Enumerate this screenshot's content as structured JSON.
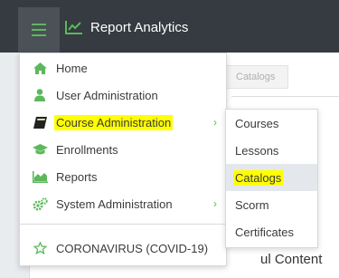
{
  "header": {
    "app_title": "Report Analytics",
    "menu_icon": "hamburger-icon",
    "brand_icon": "line-chart-icon",
    "accent": "#5cb85c",
    "bar_color": "#353b40"
  },
  "background": {
    "breadcrumb": "Catalogs",
    "heading_fragment": "ul Content"
  },
  "menu": {
    "items": [
      {
        "label": "Home",
        "icon": "home-icon"
      },
      {
        "label": "User Administration",
        "icon": "user-icon"
      },
      {
        "label": "Course Administration",
        "icon": "book-icon",
        "highlighted": true,
        "has_submenu": true
      },
      {
        "label": "Enrollments",
        "icon": "graduation-cap-icon"
      },
      {
        "label": "Reports",
        "icon": "area-chart-icon"
      },
      {
        "label": "System Administration",
        "icon": "cogs-icon",
        "has_submenu": true
      }
    ],
    "footer_item": {
      "label": "CORONAVIRUS (COVID-19)",
      "icon": "star-icon"
    }
  },
  "submenu": {
    "items": [
      {
        "label": "Courses"
      },
      {
        "label": "Lessons"
      },
      {
        "label": "Catalogs",
        "highlighted": true,
        "active": true
      },
      {
        "label": "Scorm"
      },
      {
        "label": "Certificates"
      }
    ]
  }
}
